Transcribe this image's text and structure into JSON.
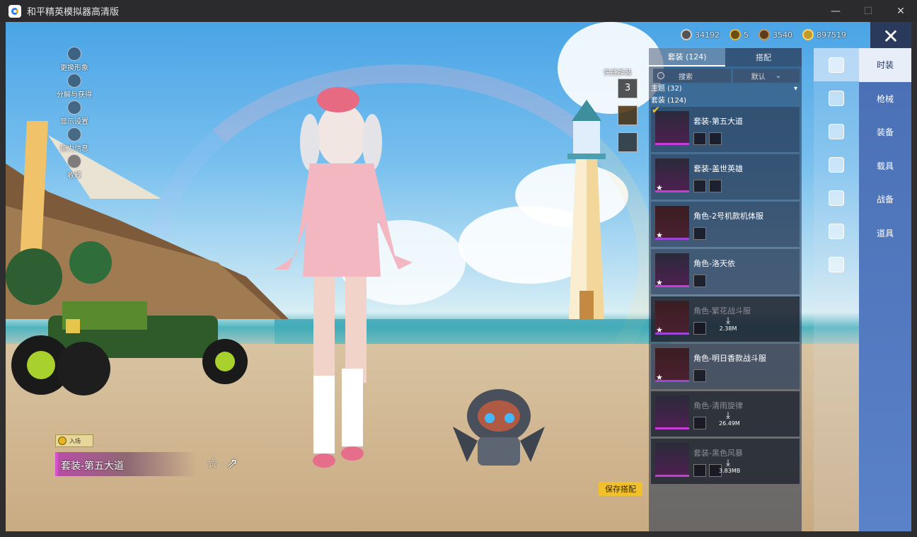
{
  "window": {
    "title": "和平精英模拟器高清版",
    "controls": [
      "—",
      "☐",
      "✕"
    ]
  },
  "currency": [
    {
      "icon": "silver-coin-icon",
      "value": "34192"
    },
    {
      "icon": "gold-badge-icon",
      "value": "5"
    },
    {
      "icon": "bronze-coin-icon",
      "value": "3540"
    },
    {
      "icon": "gold-coin-icon",
      "value": "897519"
    }
  ],
  "left_menu": [
    {
      "label": "更换形象",
      "icon": "person-icon"
    },
    {
      "label": "分解与获得",
      "icon": "dismantle-icon"
    },
    {
      "label": "显示设置",
      "icon": "eye-icon"
    },
    {
      "label": "能力信息",
      "icon": "hand-icon"
    },
    {
      "label": "收藏",
      "icon": "badge-icon"
    }
  ],
  "quick_swap": {
    "label": "快捷换装",
    "slot_badge": "3"
  },
  "current_outfit": {
    "tag": "入场",
    "name": "套装-第五大道"
  },
  "save_button": "保存搭配",
  "panel": {
    "tabs": [
      {
        "label": "套装 (124)",
        "active": true
      },
      {
        "label": "搭配",
        "active": false
      }
    ],
    "search_placeholder": "搜索",
    "sort_label": "默认",
    "theme_label": "主题 (32)",
    "group_label": "套装 (124)",
    "items": [
      {
        "name": "套装-第五大道",
        "selected": true,
        "downloadable": false,
        "star": false,
        "minis": 2
      },
      {
        "name": "套装-盖世英雄",
        "selected": false,
        "downloadable": false,
        "star": true,
        "minis": 2
      },
      {
        "name": "角色-2号机款机体服",
        "selected": false,
        "downloadable": false,
        "star": true,
        "minis": 1
      },
      {
        "name": "角色-洛天依",
        "selected": false,
        "downloadable": false,
        "star": true,
        "minis": 1
      },
      {
        "name": "角色-繁花战斗服",
        "selected": false,
        "downloadable": true,
        "size": "2.38M",
        "star": true,
        "minis": 1
      },
      {
        "name": "角色-明日香款战斗服",
        "selected": false,
        "downloadable": false,
        "star": true,
        "minis": 1
      },
      {
        "name": "角色-清雨旋律",
        "selected": false,
        "downloadable": true,
        "size": "26.49M",
        "star": false,
        "minis": 1
      },
      {
        "name": "套装-黑色风暴",
        "selected": false,
        "downloadable": true,
        "size": "3.83MB",
        "star": false,
        "minis": 2
      }
    ]
  },
  "categories": [
    {
      "label": "时装",
      "icon": "outfit-icon",
      "active": true
    },
    {
      "label": "枪械",
      "icon": "gun-icon",
      "active": false
    },
    {
      "label": "装备",
      "icon": "goggles-icon",
      "active": false
    },
    {
      "label": "载具",
      "icon": "mask-icon",
      "active": false
    },
    {
      "label": "战备",
      "icon": "shirt-icon",
      "active": false
    },
    {
      "label": "道具",
      "icon": "pants-icon",
      "active": false
    },
    {
      "label": "",
      "icon": "shoes-icon",
      "active": false
    }
  ]
}
